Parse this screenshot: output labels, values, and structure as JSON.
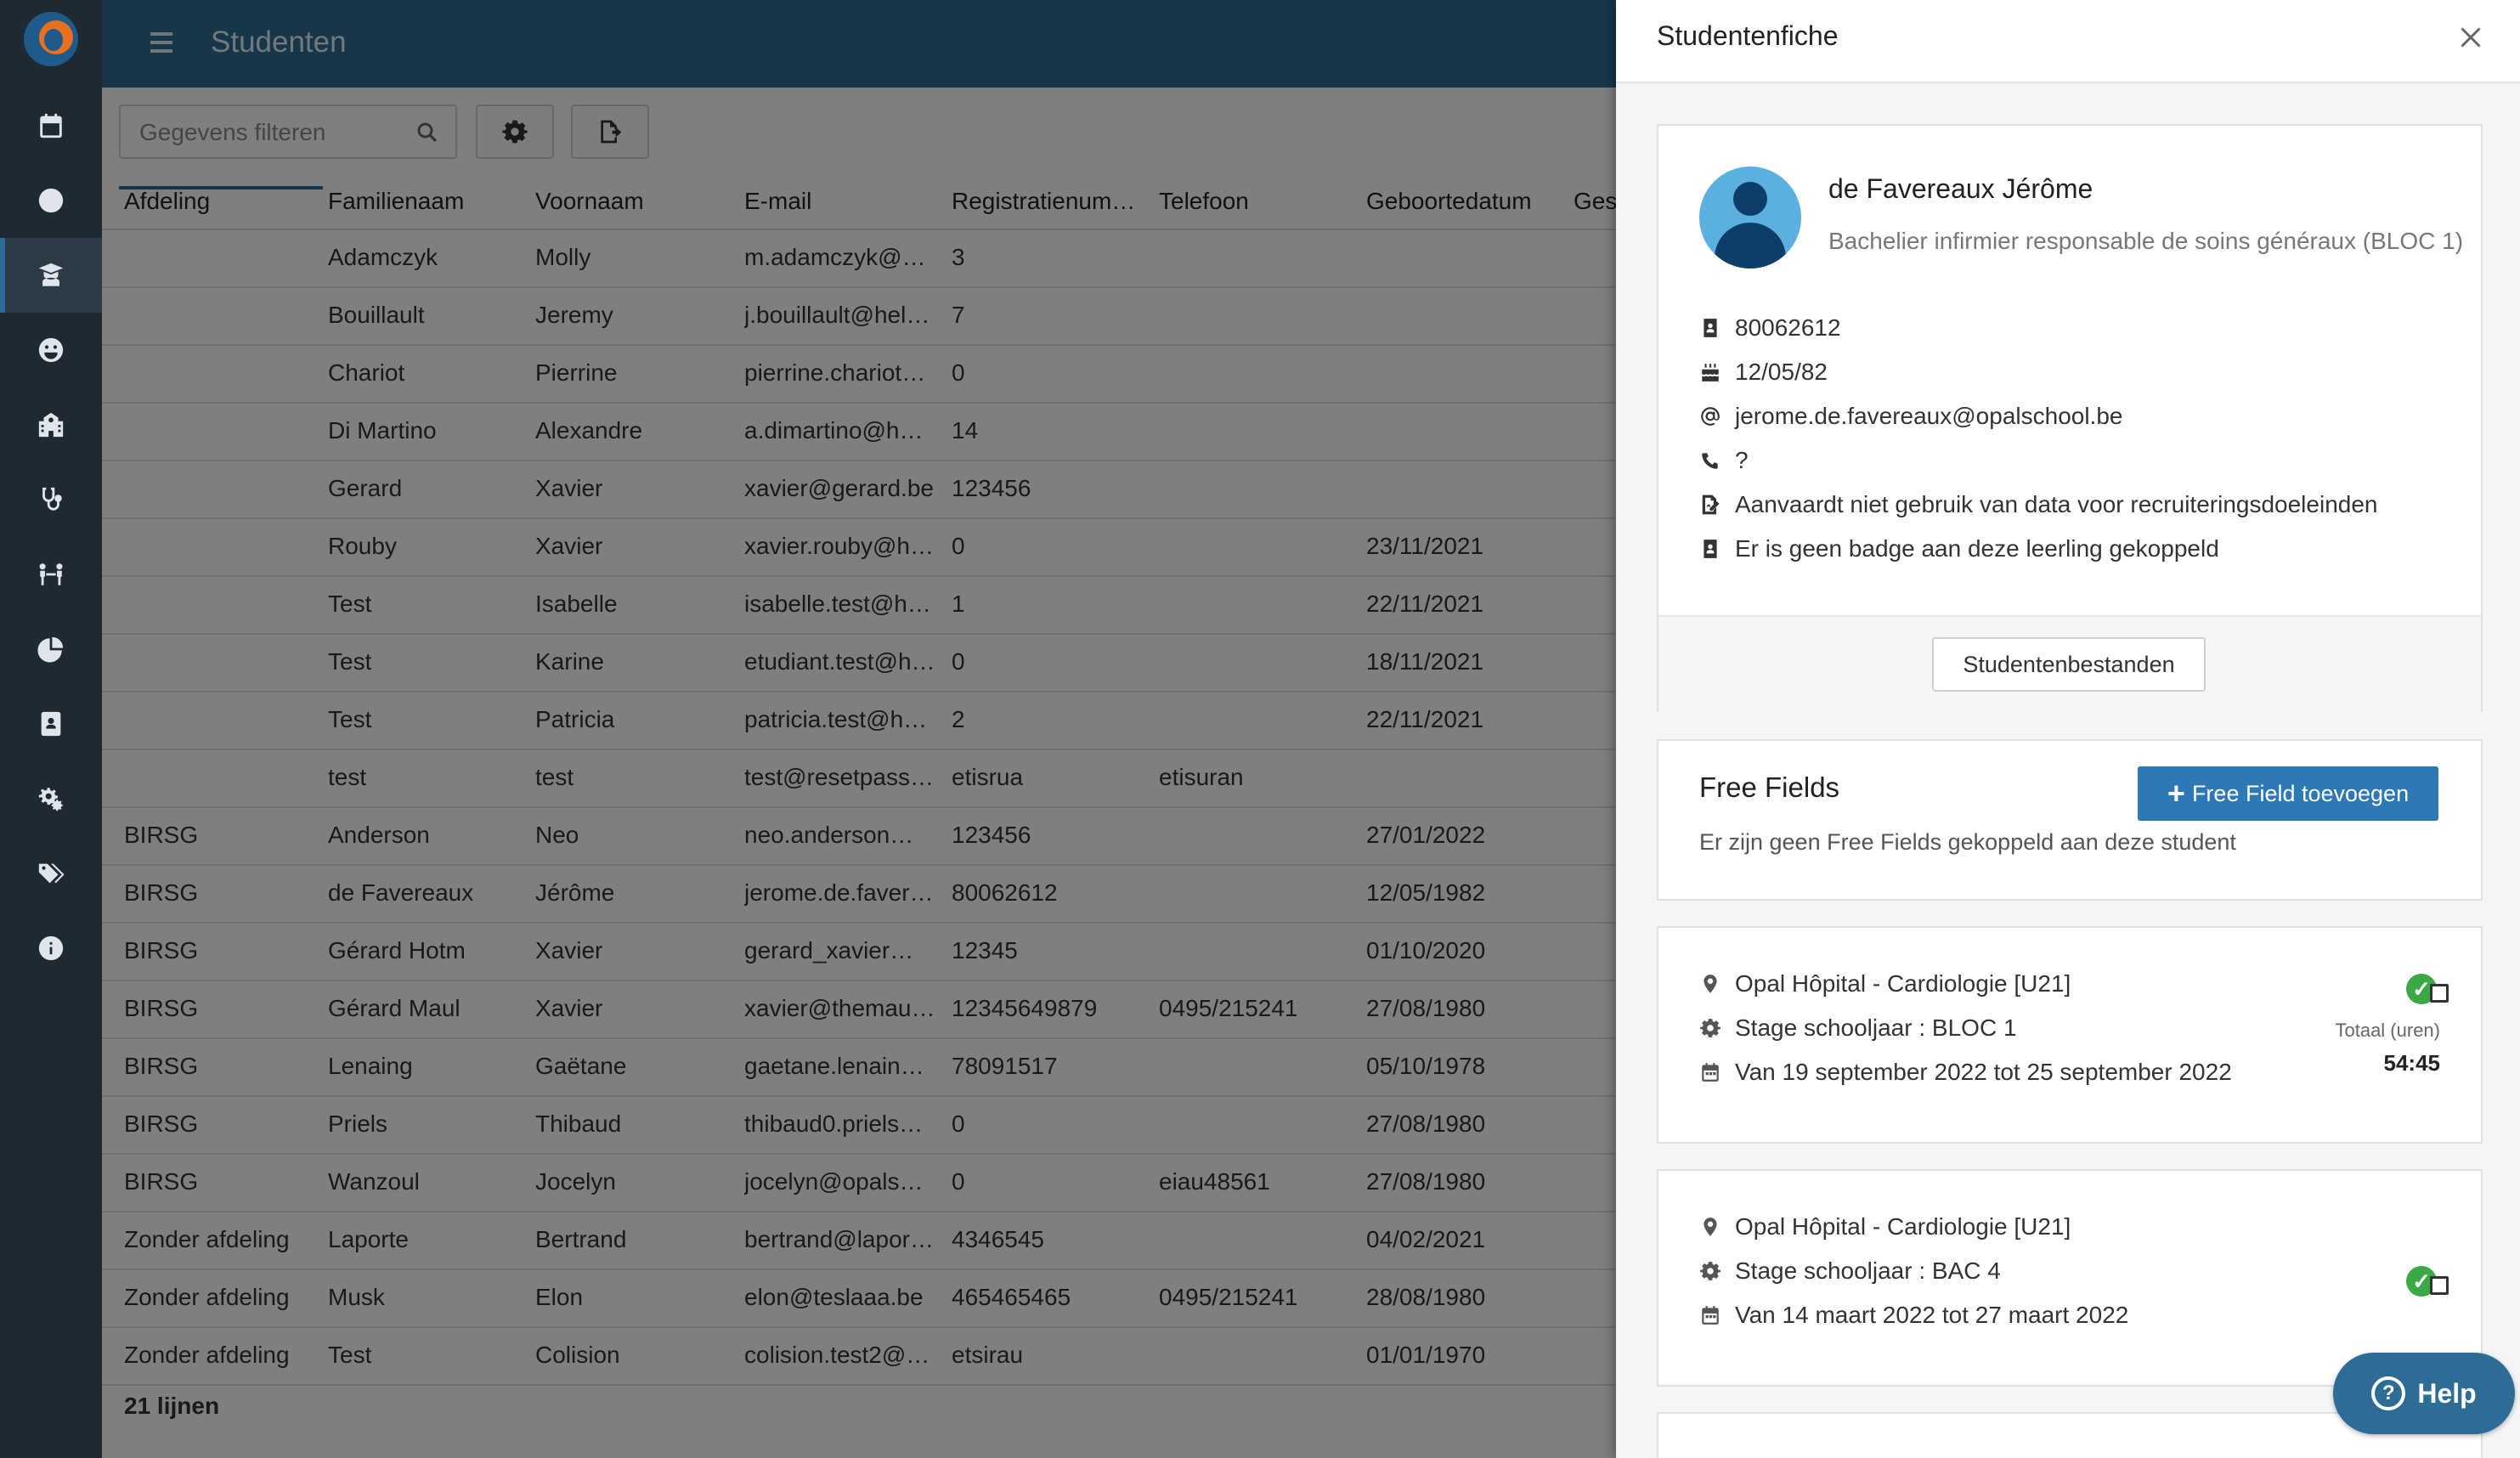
{
  "header": {
    "title": "Studenten"
  },
  "toolbar": {
    "filter_placeholder": "Gegevens filteren"
  },
  "table": {
    "columns": [
      "Afdeling",
      "Familienaam",
      "Voornaam",
      "E-mail",
      "Registratienum…",
      "Telefoon",
      "Geboortedatum",
      "Gesl"
    ],
    "rows": [
      [
        "",
        "Adamczyk",
        "Molly",
        "m.adamczyk@h…",
        "3",
        "",
        ""
      ],
      [
        "",
        "Bouillault",
        "Jeremy",
        "j.bouillault@hel…",
        "7",
        "",
        ""
      ],
      [
        "",
        "Chariot",
        "Pierrine",
        "pierrine.chariot…",
        "0",
        "",
        ""
      ],
      [
        "",
        "Di Martino",
        "Alexandre",
        "a.dimartino@hel…",
        "14",
        "",
        ""
      ],
      [
        "",
        "Gerard",
        "Xavier",
        "xavier@gerard.be",
        "123456",
        "",
        ""
      ],
      [
        "",
        "Rouby",
        "Xavier",
        "xavier.rouby@hel…",
        "0",
        "",
        "23/11/2021"
      ],
      [
        "",
        "Test",
        "Isabelle",
        "isabelle.test@he…",
        "1",
        "",
        "22/11/2021"
      ],
      [
        "",
        "Test",
        "Karine",
        "etudiant.test@he…",
        "0",
        "",
        "18/11/2021"
      ],
      [
        "",
        "Test",
        "Patricia",
        "patricia.test@hel…",
        "2",
        "",
        "22/11/2021"
      ],
      [
        "",
        "test",
        "test",
        "test@resetpass…",
        "etisrua",
        "etisuran",
        ""
      ],
      [
        "BIRSG",
        "Anderson",
        "Neo",
        "neo.anderson@…",
        "123456",
        "",
        "27/01/2022"
      ],
      [
        "BIRSG",
        "de Favereaux",
        "Jérôme",
        "jerome.de.favere…",
        "80062612",
        "",
        "12/05/1982"
      ],
      [
        "BIRSG",
        "Gérard Hotm",
        "Xavier",
        "gerard_xavier@h…",
        "12345",
        "",
        "01/10/2020"
      ],
      [
        "BIRSG",
        "Gérard Maul",
        "Xavier",
        "xavier@themaul.…",
        "12345649879",
        "0495/215241",
        "27/08/1980"
      ],
      [
        "BIRSG",
        "Lenaing",
        "Gaëtane",
        "gaetane.lenaing…",
        "78091517",
        "",
        "05/10/1978"
      ],
      [
        "BIRSG",
        "Priels",
        "Thibaud",
        "thibaud0.priels@…",
        "0",
        "",
        "27/08/1980"
      ],
      [
        "BIRSG",
        "Wanzoul",
        "Jocelyn",
        "jocelyn@opalsol…",
        "0",
        "eiau48561",
        "27/08/1980"
      ],
      [
        "Zonder afdeling",
        "Laporte",
        "Bertrand",
        "bertrand@laport…",
        "4346545",
        "",
        "04/02/2021"
      ],
      [
        "Zonder afdeling",
        "Musk",
        "Elon",
        "elon@teslaaa.be",
        "465465465",
        "0495/215241",
        "28/08/1980"
      ],
      [
        "Zonder afdeling",
        "Test",
        "Colision",
        "colision.test2@t…",
        "etsirau",
        "",
        "01/01/1970"
      ]
    ],
    "count_label": "21 lijnen"
  },
  "panel": {
    "title": "Studentenfiche",
    "student": {
      "name": "de Favereaux Jérôme",
      "program": "Bachelier infirmier responsable de soins généraux (BLOC 1)",
      "registration": "80062612",
      "birthdate": "12/05/82",
      "email": "jerome.de.favereaux@opalschool.be",
      "phone": "?",
      "data_consent": "Aanvaardt niet gebruik van data voor recruiteringsdoeleinden",
      "badge": "Er is geen badge aan deze leerling gekoppeld",
      "files_button": "Studentenbestanden"
    },
    "free_fields": {
      "title": "Free Fields",
      "add_button": "Free Field toevoegen",
      "empty_text": "Er zijn geen Free Fields gekoppeld aan deze student"
    },
    "internships": [
      {
        "location": "Opal Hôpital - Cardiologie [U21]",
        "year": "Stage schooljaar : BLOC 1",
        "period": "Van 19 september 2022 tot 25 september 2022",
        "total_label": "Totaal (uren)",
        "total_value": "54:45"
      },
      {
        "location": "Opal Hôpital - Cardiologie [U21]",
        "year": "Stage schooljaar : BAC 4",
        "period": "Van 14 maart 2022 tot 27 maart 2022"
      }
    ]
  },
  "help": {
    "label": "Help"
  },
  "colors": {
    "sidebar": "#1e2a33",
    "header": "#2c6c95",
    "accent": "#2c79b5",
    "success": "#3aa845"
  },
  "icons": {
    "sidebar": [
      "calendar-icon",
      "clock-icon",
      "graduate-icon",
      "smiley-icon",
      "school-icon",
      "stethoscope-icon",
      "people-icon",
      "pie-chart-icon",
      "badge-icon",
      "settings-icon",
      "tags-icon",
      "info-icon"
    ]
  }
}
